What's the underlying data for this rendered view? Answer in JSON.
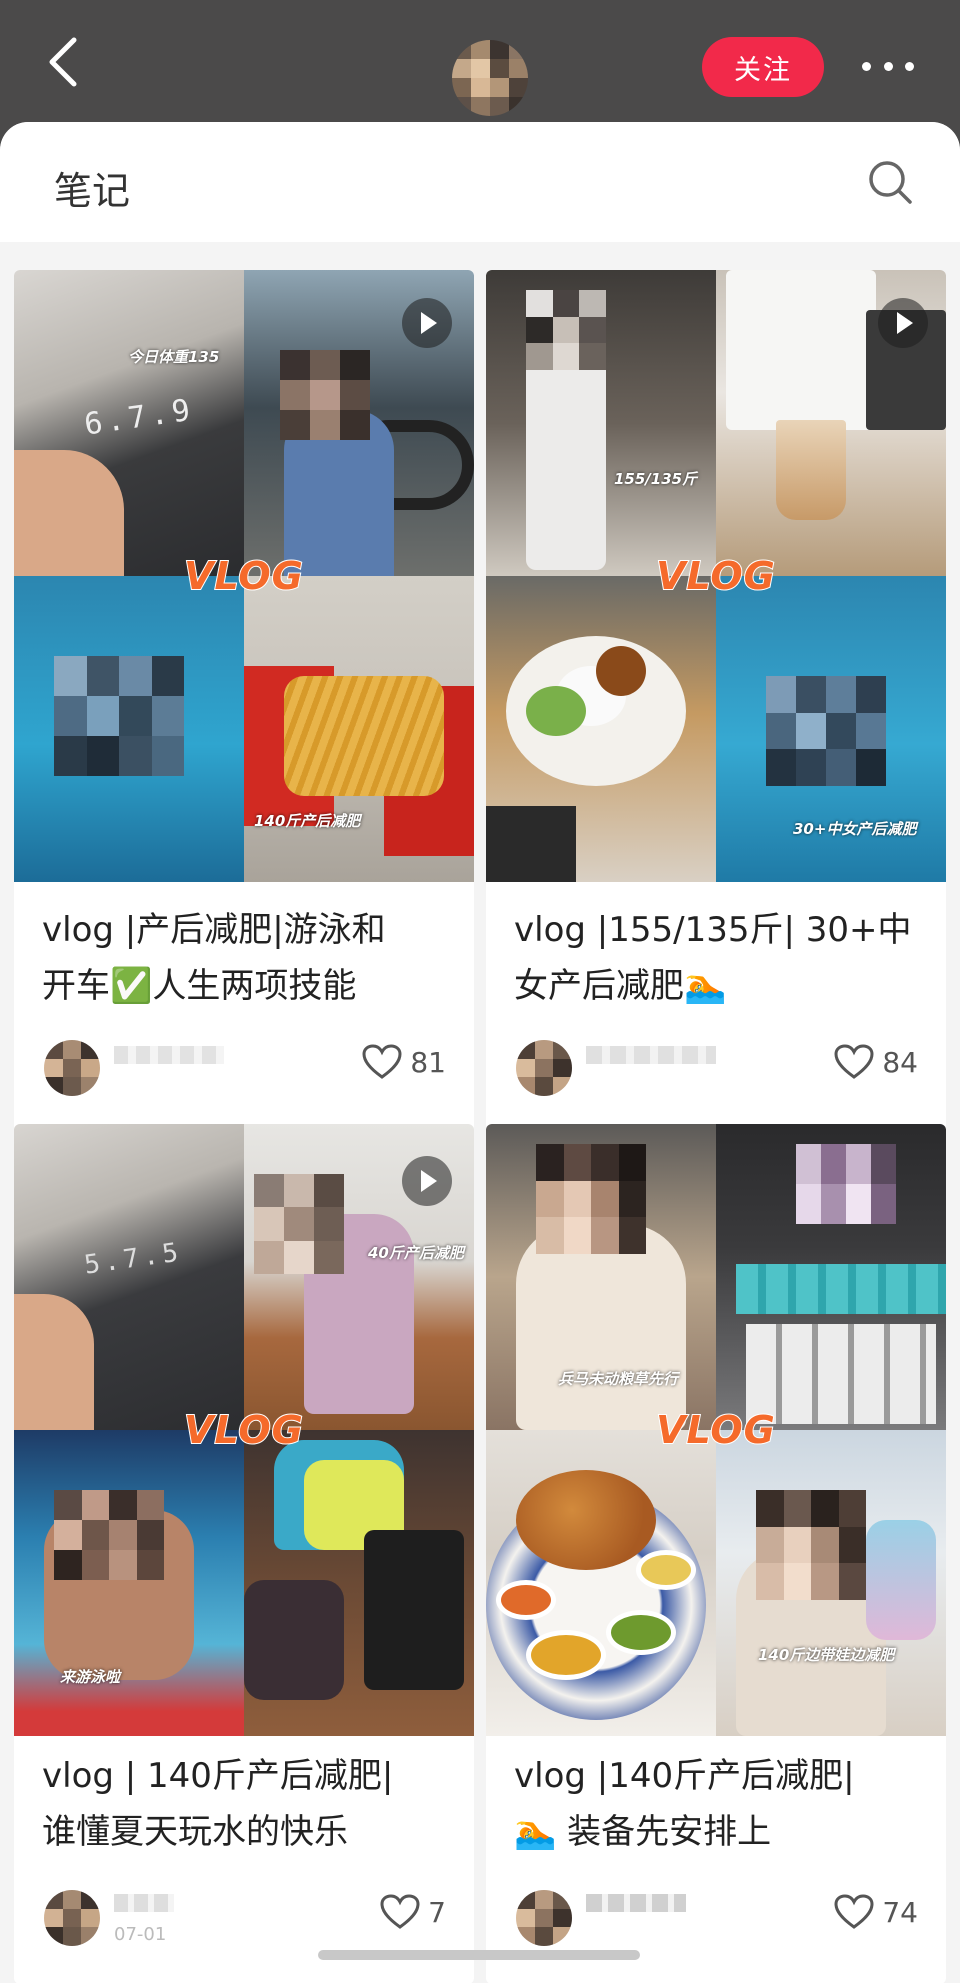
{
  "header": {
    "follow_label": "关注",
    "colors": {
      "bar": "#4b4a4a",
      "accent": "#f2294a"
    }
  },
  "panel": {
    "title": "笔记"
  },
  "notes": [
    {
      "title_line1": "vlog |产后减肥|游泳和",
      "title_line2": "开车✅人生两项技能",
      "likes": "81",
      "overlay_texts": [
        "今日体重135",
        "140斤产后减肥"
      ],
      "badge": "VLOG"
    },
    {
      "title_line1": "vlog |155/135斤| 30+中",
      "title_line2": "女产后减肥🏊",
      "likes": "84",
      "overlay_texts": [
        "155/135斤",
        "30+中女产后减肥"
      ],
      "badge": "VLOG"
    },
    {
      "title_line1": "vlog | 140斤产后减肥|",
      "title_line2": "谁懂夏天玩水的快乐",
      "likes": "7",
      "date": "07-01",
      "overlay_texts": [
        "40斤产后减肥",
        "来游泳啦"
      ],
      "badge": "VLOG"
    },
    {
      "title_line1": "vlog |140斤产后减肥|",
      "title_line2": "🏊 装备先安排上",
      "likes": "74",
      "overlay_texts": [
        "兵马未动粮草先行",
        "140斤边带娃边减肥"
      ],
      "badge": "VLOG"
    }
  ],
  "icons": [
    "back-chevron-icon",
    "more-dots-icon",
    "search-icon",
    "heart-icon",
    "play-icon"
  ]
}
